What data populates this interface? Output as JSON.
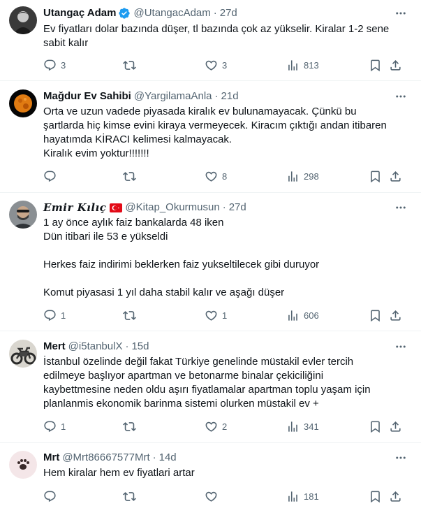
{
  "tweets": [
    {
      "name": "Utangaç Adam",
      "handle": "@UtangacAdam",
      "time": "27d",
      "verified": true,
      "lines": [
        "Ev fiyatları dolar bazında düşer, tl bazında çok az yükselir. Kiralar 1-2 sene",
        "sabit kalır"
      ],
      "replies": "3",
      "retweets": "",
      "likes": "3",
      "views": "813"
    },
    {
      "name": "Mağdur Ev Sahibi",
      "handle": "@YargilamaAnla",
      "time": "21d",
      "lines": [
        "Orta ve uzun vadede piyasada kiralık ev bulunamayacak. Çünkü bu",
        "şartlarda hiç kimse evini kiraya vermeyecek. Kiracım çıktığı andan itibaren",
        "hayatımda KİRACI kelimesi kalmayacak.",
        "Kiralık evim yoktur!!!!!!!"
      ],
      "replies": "",
      "retweets": "",
      "likes": "8",
      "views": "298"
    },
    {
      "name": "Emir Kılıç",
      "handle": "@Kitap_Okurmusun",
      "time": "27d",
      "flag": true,
      "lines": [
        "1 ay önce aylık faiz bankalarda 48 iken",
        "Dün itibari ile 53 e yükseldi",
        "",
        "Herkes faiz indirimi beklerken faiz yukseltilecek gibi duruyor",
        "",
        "Komut piyasasi 1 yıl daha stabil kalır ve aşağı düşer"
      ],
      "replies": "1",
      "retweets": "",
      "likes": "1",
      "views": "606"
    },
    {
      "name": "Mert",
      "handle": "@i5tanbulX",
      "time": "15d",
      "lines": [
        "İstanbul özelinde değil fakat Türkiye genelinde müstakil evler tercih",
        "edilmeye başlıyor apartman ve betonarme binalar çekiciliğini",
        "kaybettmesine neden oldu aşırı fiyatlamalar apartman toplu yaşam için",
        "planlanmis ekonomik barinma sistemi olurken müstakil ev +"
      ],
      "replies": "1",
      "retweets": "",
      "likes": "2",
      "views": "341"
    },
    {
      "name": "Mrt",
      "handle": "@Mrt86667577Mrt",
      "time": "14d",
      "lines": [
        "Hem kiralar hem ev fiyatlari artar"
      ],
      "replies": "",
      "retweets": "",
      "likes": "",
      "views": "181"
    }
  ],
  "separator": "·",
  "colors": {
    "text": "#0f1419",
    "secondary": "#536471",
    "verified": "#1d9bf0",
    "divider": "#eff3f4",
    "flag": "#e30a17"
  },
  "icons": [
    "verified-badge-icon",
    "more-icon",
    "reply-icon",
    "retweet-icon",
    "like-icon",
    "views-icon",
    "bookmark-icon",
    "share-icon",
    "turkey-flag-icon"
  ]
}
